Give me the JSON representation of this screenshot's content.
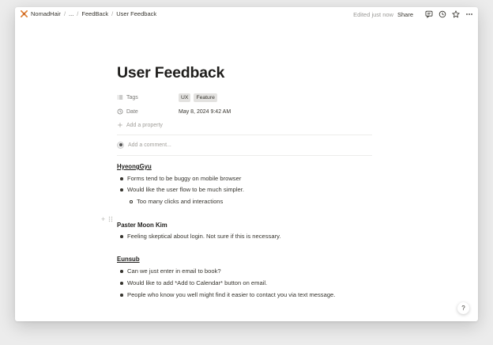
{
  "breadcrumb": {
    "workspace": "NomadHair",
    "ellipsis": "...",
    "parent": "FeedBack",
    "current": "User Feedback"
  },
  "topbar": {
    "edited": "Edited just now",
    "share": "Share",
    "icons": [
      "comment-icon",
      "clock-icon",
      "star-icon",
      "more-icon"
    ]
  },
  "page": {
    "title": "User Feedback",
    "properties": {
      "tags_label": "Tags",
      "tags": [
        "UX",
        "Feature"
      ],
      "date_label": "Date",
      "date_value": "May 8, 2024 9:42 AM",
      "add_property": "Add a property"
    },
    "comment_placeholder": "Add a comment..."
  },
  "sections": [
    {
      "name": "HyeongGyu",
      "items": [
        "Forms tend to be buggy on mobile browser",
        "Would like the user flow to be much simpler.",
        "Too many clicks and interactions"
      ]
    },
    {
      "name": "Paster Moon Kim",
      "items": [
        "Feeling skeptical about login. Not sure if this is necessary."
      ]
    },
    {
      "name": "Eunsub",
      "items": [
        "Can we just enter in email to book?",
        "Would like to add *Add to Calendar* button on email.",
        "People who know you well might find it easier to contact you via text message."
      ]
    }
  ],
  "help": "?"
}
